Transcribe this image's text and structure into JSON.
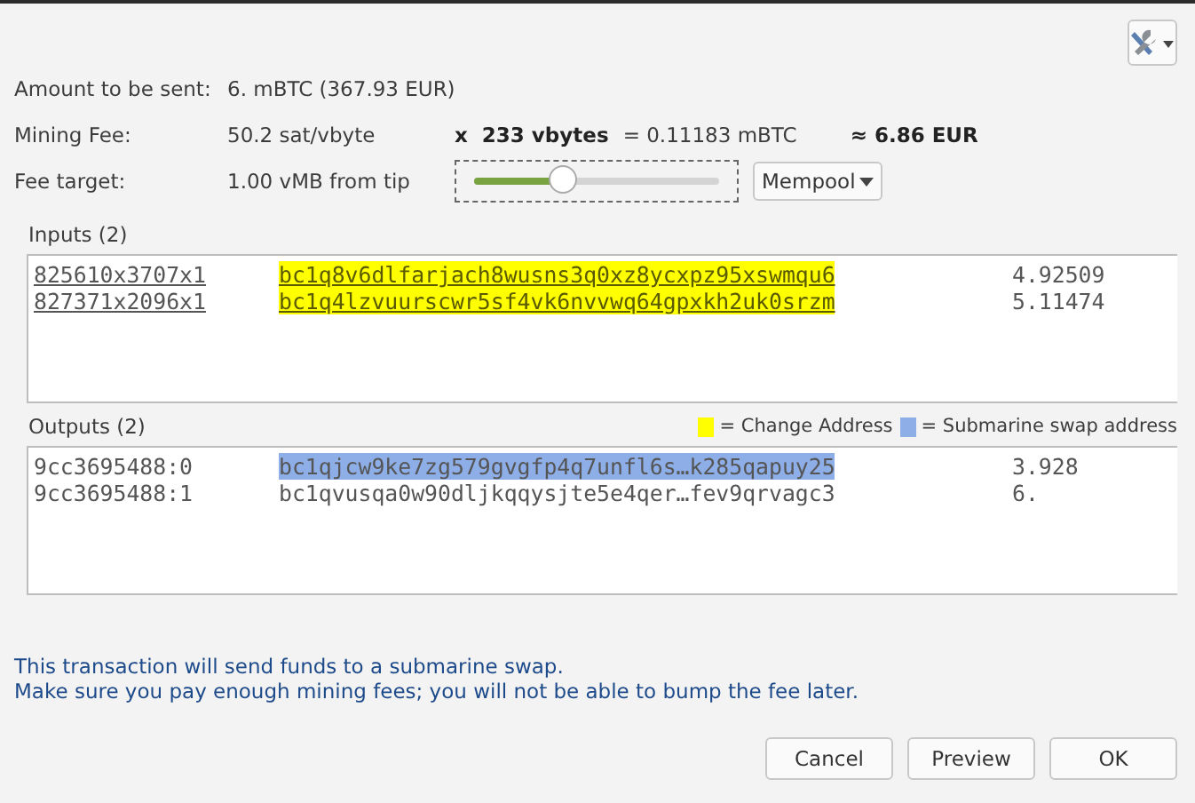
{
  "amount": {
    "label": "Amount to be sent:",
    "value": "6. mBTC (367.93 EUR)"
  },
  "mining_fee": {
    "label": "Mining Fee:",
    "rate": "50.2 sat/vbyte",
    "times": "x",
    "size": "233 vbytes",
    "equals": "= 0.11183 mBTC",
    "approx": "≈ 6.86 EUR"
  },
  "fee_target": {
    "label": "Fee target:",
    "value": "1.00 vMB from tip",
    "level": 0.36,
    "method": "Mempool"
  },
  "inputs": {
    "title": "Inputs (2)",
    "rows": [
      {
        "prevout": "825610x3707x1",
        "address": "bc1q8v6dlfarjach8wusns3q0xz8ycxpz95xswmqu6",
        "amount": "4.92509",
        "kind": "change"
      },
      {
        "prevout": "827371x2096x1",
        "address": "bc1q4lzvuurscwr5sf4vk6nvvwq64gpxkh2uk0srzm",
        "amount": "5.11474",
        "kind": "change"
      }
    ]
  },
  "legend": [
    {
      "color": "#ffff00",
      "label": "= Change Address"
    },
    {
      "color": "#8eaee8",
      "label": "= Submarine swap address"
    }
  ],
  "outputs": {
    "title": "Outputs (2)",
    "rows": [
      {
        "prevout": "9cc3695488:0",
        "address": "bc1qjcw9ke7zg579gvgfp4q7unfl6s…k285qapuy25",
        "amount": "3.928",
        "kind": "swap"
      },
      {
        "prevout": "9cc3695488:1",
        "address": "bc1qvusqa0w90dljkqqysjte5e4qer…fev9qrvagc3",
        "amount": "6.",
        "kind": "plain"
      }
    ]
  },
  "message": [
    "This transaction will send funds to a submarine swap.",
    "Make sure you pay enough mining fees; you will not be able to bump the fee later."
  ],
  "buttons": [
    "Cancel",
    "Preview",
    "OK"
  ]
}
